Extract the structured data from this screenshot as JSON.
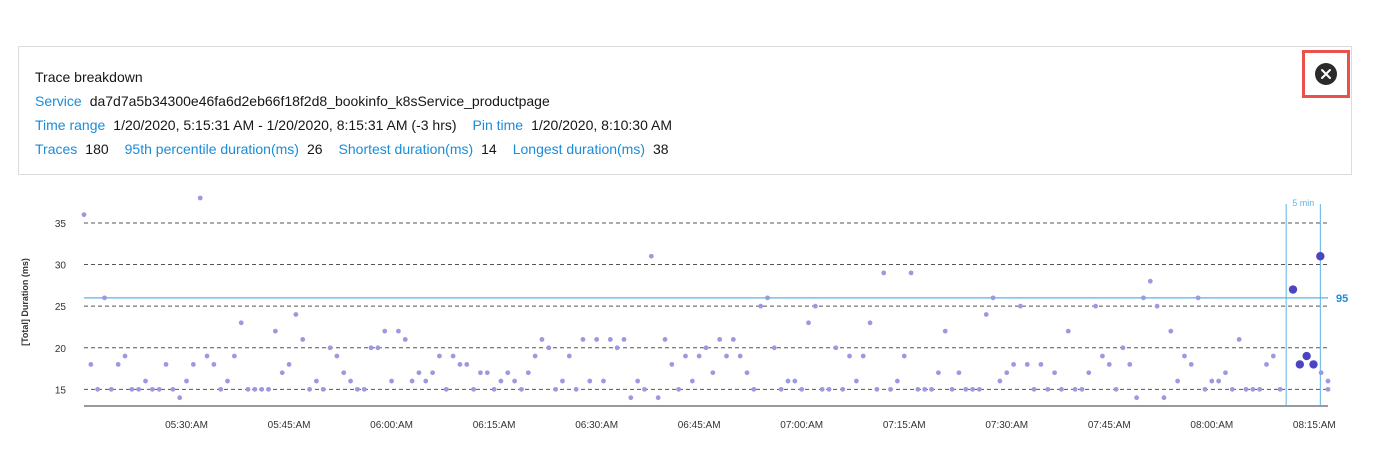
{
  "panel": {
    "title": "Trace breakdown",
    "service_label": "Service",
    "service_value": "da7d7a5b34300e46fa6d2eb66f18f2d8_bookinfo_k8sService_productpage",
    "time_range_label": "Time range",
    "time_range_value": "1/20/2020, 5:15:31 AM - 1/20/2020, 8:15:31 AM (-3 hrs)",
    "pin_time_label": "Pin time",
    "pin_time_value": "1/20/2020, 8:10:30 AM",
    "traces_label": "Traces",
    "traces_value": "180",
    "p95_label": "95th percentile duration(ms)",
    "p95_value": "26",
    "shortest_label": "Shortest duration(ms)",
    "shortest_value": "14",
    "longest_label": "Longest duration(ms)",
    "longest_value": "38"
  },
  "close_icon": "close-icon",
  "colors": {
    "accent": "#1a8cd8",
    "point": "#9d99e0",
    "point_highlight": "#4b45c2",
    "percentile_line": "#5ab4e6",
    "highlight_border": "#e8524a"
  },
  "chart_data": {
    "type": "scatter",
    "ylabel": "[Total] Duration (ms)",
    "ylim": [
      13,
      38
    ],
    "yticks": [
      15,
      20,
      25,
      30,
      35
    ],
    "xticks": [
      "05:30:AM",
      "05:45:AM",
      "06:00:AM",
      "06:15:AM",
      "06:30:AM",
      "06:45:AM",
      "07:00:AM",
      "07:15:AM",
      "07:30:AM",
      "07:45:AM",
      "08:00:AM",
      "08:15:AM"
    ],
    "xlim": [
      "05:15",
      "08:17"
    ],
    "grid": "horizontal-dashed",
    "percentile_label": "95",
    "percentile_value": 26,
    "window_label": "5 min",
    "window_range": [
      "08:10",
      "08:15"
    ],
    "series": [
      {
        "values": [
          [
            "05:15",
            36
          ],
          [
            "05:16",
            18
          ],
          [
            "05:17",
            15
          ],
          [
            "05:18",
            26
          ],
          [
            "05:19",
            15
          ],
          [
            "05:20",
            18
          ],
          [
            "05:21",
            19
          ],
          [
            "05:22",
            15
          ],
          [
            "05:23",
            15
          ],
          [
            "05:24",
            16
          ],
          [
            "05:25",
            15
          ],
          [
            "05:26",
            15
          ],
          [
            "05:27",
            18
          ],
          [
            "05:28",
            15
          ],
          [
            "05:29",
            14
          ],
          [
            "05:30",
            16
          ],
          [
            "05:31",
            18
          ],
          [
            "05:32",
            38
          ],
          [
            "05:33",
            19
          ],
          [
            "05:34",
            18
          ],
          [
            "05:35",
            15
          ],
          [
            "05:36",
            16
          ],
          [
            "05:37",
            19
          ],
          [
            "05:38",
            23
          ],
          [
            "05:39",
            15
          ],
          [
            "05:40",
            15
          ],
          [
            "05:41",
            15
          ],
          [
            "05:42",
            15
          ],
          [
            "05:43",
            22
          ],
          [
            "05:44",
            17
          ],
          [
            "05:45",
            18
          ],
          [
            "05:46",
            24
          ],
          [
            "05:47",
            21
          ],
          [
            "05:48",
            15
          ],
          [
            "05:49",
            16
          ],
          [
            "05:50",
            15
          ],
          [
            "05:51",
            20
          ],
          [
            "05:52",
            19
          ],
          [
            "05:53",
            17
          ],
          [
            "05:54",
            16
          ],
          [
            "05:55",
            15
          ],
          [
            "05:56",
            15
          ],
          [
            "05:57",
            20
          ],
          [
            "05:58",
            20
          ],
          [
            "05:59",
            22
          ],
          [
            "06:00",
            16
          ],
          [
            "06:01",
            22
          ],
          [
            "06:02",
            21
          ],
          [
            "06:03",
            16
          ],
          [
            "06:04",
            17
          ],
          [
            "06:05",
            16
          ],
          [
            "06:06",
            17
          ],
          [
            "06:07",
            19
          ],
          [
            "06:08",
            15
          ],
          [
            "06:09",
            19
          ],
          [
            "06:10",
            18
          ],
          [
            "06:11",
            18
          ],
          [
            "06:12",
            15
          ],
          [
            "06:13",
            17
          ],
          [
            "06:14",
            17
          ],
          [
            "06:15",
            15
          ],
          [
            "06:16",
            16
          ],
          [
            "06:17",
            17
          ],
          [
            "06:18",
            16
          ],
          [
            "06:19",
            15
          ],
          [
            "06:20",
            17
          ],
          [
            "06:21",
            19
          ],
          [
            "06:22",
            21
          ],
          [
            "06:23",
            20
          ],
          [
            "06:24",
            15
          ],
          [
            "06:25",
            16
          ],
          [
            "06:26",
            19
          ],
          [
            "06:27",
            15
          ],
          [
            "06:28",
            21
          ],
          [
            "06:29",
            16
          ],
          [
            "06:30",
            21
          ],
          [
            "06:31",
            16
          ],
          [
            "06:32",
            21
          ],
          [
            "06:33",
            20
          ],
          [
            "06:34",
            21
          ],
          [
            "06:35",
            14
          ],
          [
            "06:36",
            16
          ],
          [
            "06:37",
            15
          ],
          [
            "06:38",
            31
          ],
          [
            "06:39",
            14
          ],
          [
            "06:40",
            21
          ],
          [
            "06:41",
            18
          ],
          [
            "06:42",
            15
          ],
          [
            "06:43",
            19
          ],
          [
            "06:44",
            16
          ],
          [
            "06:45",
            19
          ],
          [
            "06:46",
            20
          ],
          [
            "06:47",
            17
          ],
          [
            "06:48",
            21
          ],
          [
            "06:49",
            19
          ],
          [
            "06:50",
            21
          ],
          [
            "06:51",
            19
          ],
          [
            "06:52",
            17
          ],
          [
            "06:53",
            15
          ],
          [
            "06:54",
            25
          ],
          [
            "06:55",
            26
          ],
          [
            "06:56",
            20
          ],
          [
            "06:57",
            15
          ],
          [
            "06:58",
            16
          ],
          [
            "06:59",
            16
          ],
          [
            "07:00",
            15
          ],
          [
            "07:01",
            23
          ],
          [
            "07:02",
            25
          ],
          [
            "07:03",
            15
          ],
          [
            "07:04",
            15
          ],
          [
            "07:05",
            20
          ],
          [
            "07:06",
            15
          ],
          [
            "07:07",
            19
          ],
          [
            "07:08",
            16
          ],
          [
            "07:09",
            19
          ],
          [
            "07:10",
            23
          ],
          [
            "07:11",
            15
          ],
          [
            "07:12",
            29
          ],
          [
            "07:13",
            15
          ],
          [
            "07:14",
            16
          ],
          [
            "07:15",
            19
          ],
          [
            "07:16",
            29
          ],
          [
            "07:17",
            15
          ],
          [
            "07:18",
            15
          ],
          [
            "07:19",
            15
          ],
          [
            "07:20",
            17
          ],
          [
            "07:21",
            22
          ],
          [
            "07:22",
            15
          ],
          [
            "07:23",
            17
          ],
          [
            "07:24",
            15
          ],
          [
            "07:25",
            15
          ],
          [
            "07:26",
            15
          ],
          [
            "07:27",
            24
          ],
          [
            "07:28",
            26
          ],
          [
            "07:29",
            16
          ],
          [
            "07:30",
            17
          ],
          [
            "07:31",
            18
          ],
          [
            "07:32",
            25
          ],
          [
            "07:33",
            18
          ],
          [
            "07:34",
            15
          ],
          [
            "07:35",
            18
          ],
          [
            "07:36",
            15
          ],
          [
            "07:37",
            17
          ],
          [
            "07:38",
            15
          ],
          [
            "07:39",
            22
          ],
          [
            "07:40",
            15
          ],
          [
            "07:41",
            15
          ],
          [
            "07:42",
            17
          ],
          [
            "07:43",
            25
          ],
          [
            "07:44",
            19
          ],
          [
            "07:45",
            18
          ],
          [
            "07:46",
            15
          ],
          [
            "07:47",
            20
          ],
          [
            "07:48",
            18
          ],
          [
            "07:49",
            14
          ],
          [
            "07:50",
            26
          ],
          [
            "07:51",
            28
          ],
          [
            "07:52",
            25
          ],
          [
            "07:53",
            14
          ],
          [
            "07:54",
            22
          ],
          [
            "07:55",
            16
          ],
          [
            "07:56",
            19
          ],
          [
            "07:57",
            18
          ],
          [
            "07:58",
            26
          ],
          [
            "07:59",
            15
          ],
          [
            "08:00",
            16
          ],
          [
            "08:01",
            16
          ],
          [
            "08:02",
            17
          ],
          [
            "08:03",
            15
          ],
          [
            "08:04",
            21
          ],
          [
            "08:05",
            15
          ],
          [
            "08:06",
            15
          ],
          [
            "08:07",
            15
          ],
          [
            "08:08",
            18
          ],
          [
            "08:09",
            19
          ],
          [
            "08:10",
            15
          ],
          [
            "08:16",
            17
          ],
          [
            "08:17",
            16
          ],
          [
            "08:17",
            15
          ]
        ]
      },
      {
        "values": [
          [
            "08:11",
            27
          ],
          [
            "08:12",
            18
          ],
          [
            "08:13",
            19
          ],
          [
            "08:14",
            18
          ],
          [
            "08:15",
            31
          ]
        ]
      }
    ]
  }
}
